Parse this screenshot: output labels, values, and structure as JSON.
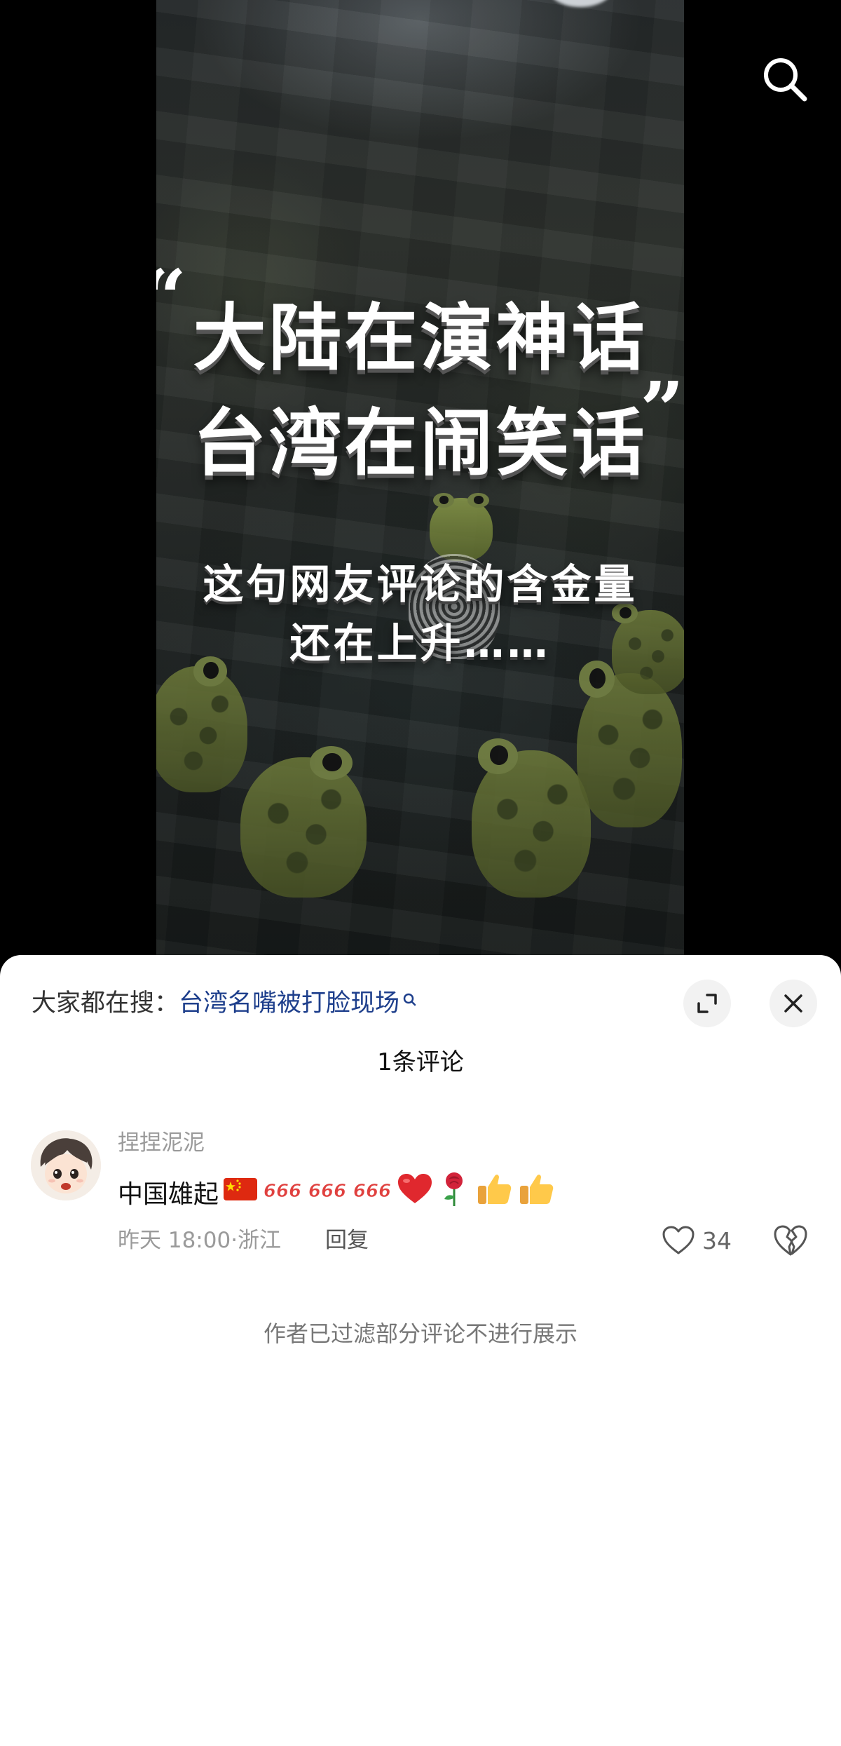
{
  "video": {
    "headline_line1": "大陆在演神话",
    "headline_line2": "台湾在闹笑话",
    "quote_open": "“",
    "quote_close": "”",
    "subtitle_line1": "这句网友评论的含金量",
    "subtitle_line2": "还在上升……",
    "search_icon": "search-icon"
  },
  "sheet": {
    "trending_prefix": "大家都在搜：",
    "trending_query": "台湾名嘴被打脸现场",
    "expand_icon": "expand-icon",
    "close_icon": "close-icon",
    "comment_count_label": "1条评论",
    "comments": [
      {
        "username": "捏捏泥泥",
        "text": "中国雄起",
        "emojis": [
          "flag-cn",
          "666",
          "666",
          "666",
          "red-heart",
          "rose",
          "thumbs-up",
          "thumbs-up"
        ],
        "emoji_666_label": "666",
        "time_location": "昨天 18:00·浙江",
        "reply_label": "回复",
        "like_count": "34"
      }
    ],
    "filtered_notice": "作者已过滤部分评论不进行展示"
  },
  "colors": {
    "link": "#1e3f8c",
    "muted": "#9a9a9a",
    "sheet_bg": "#ffffff",
    "button_bg": "#f2f2f2",
    "emoji_666": "#e0413f"
  }
}
